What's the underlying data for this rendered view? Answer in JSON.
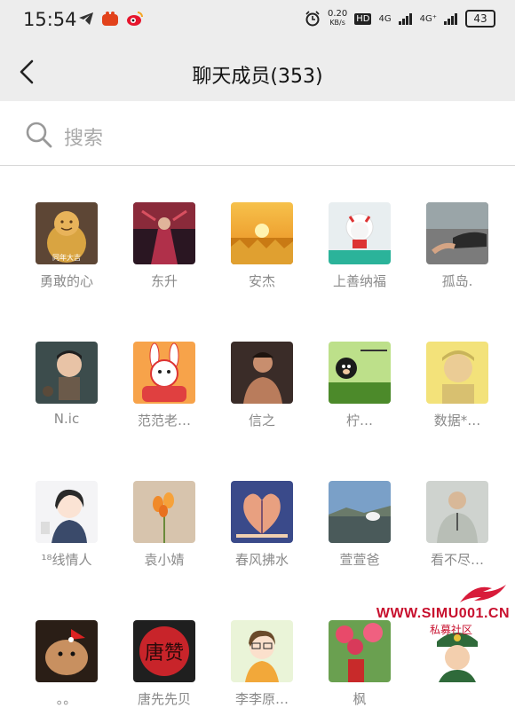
{
  "status": {
    "time": "15:54",
    "net_speed": "0.20",
    "net_unit": "KB/s",
    "hd": "HD",
    "net1": "4G",
    "net2": "4G⁺",
    "battery": "43"
  },
  "header": {
    "title": "聊天成员(353)"
  },
  "search": {
    "placeholder": "搜索"
  },
  "members": [
    {
      "name": "勇敢的心"
    },
    {
      "name": "东升"
    },
    {
      "name": "安杰"
    },
    {
      "name": "上善纳福"
    },
    {
      "name": "孤岛."
    },
    {
      "name": "N.ic"
    },
    {
      "name": "范范老…"
    },
    {
      "name": "信之"
    },
    {
      "name": "柠…"
    },
    {
      "name": "数据*…"
    },
    {
      "name": "¹⁸线情人"
    },
    {
      "name": "袁小婧"
    },
    {
      "name": "春风拂水"
    },
    {
      "name": "萱萱爸"
    },
    {
      "name": "看不尽…"
    },
    {
      "name": "。。"
    },
    {
      "name": "唐先先贝"
    },
    {
      "name": "李李原…"
    },
    {
      "name": "枫"
    },
    {
      "name": ""
    }
  ],
  "avatar_text": {
    "a1": "同年大吉",
    "a17": "唐赞"
  },
  "watermark": {
    "url": "WWW.SIMU001.CN",
    "sub": "私募社区"
  }
}
